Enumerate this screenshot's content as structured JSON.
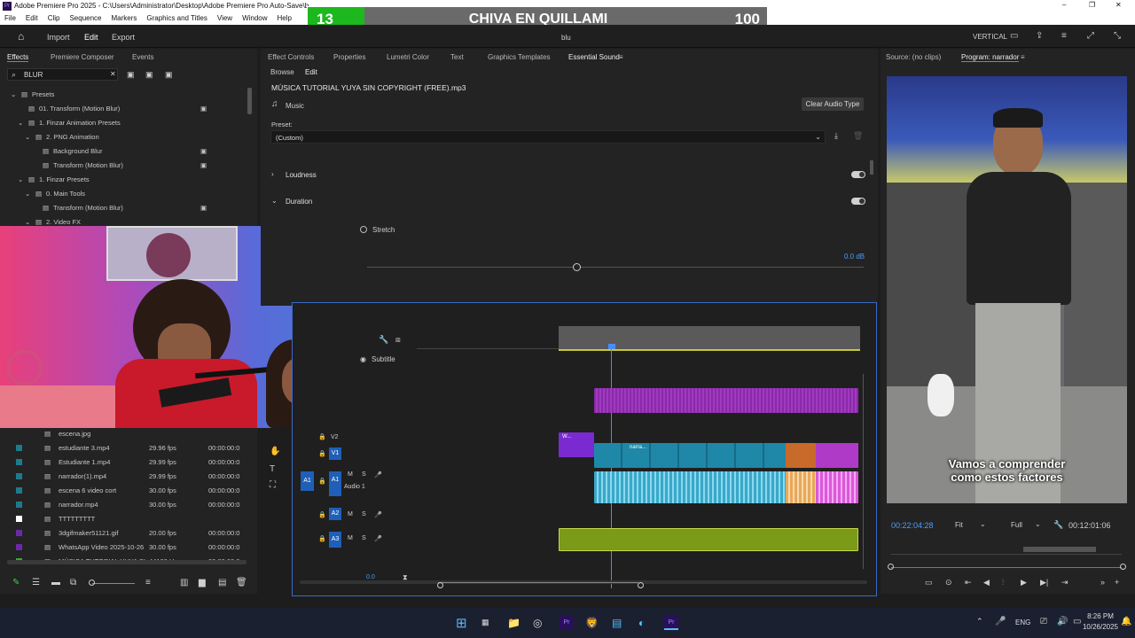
{
  "window": {
    "title": "Adobe Premiere Pro 2025 - C:\\Users\\Administrator\\Desktop\\Adobe Premiere Pro Auto-Save\\b",
    "minimize": "–",
    "maximize": "❐",
    "close": "✕"
  },
  "menu": [
    "File",
    "Edit",
    "Clip",
    "Sequence",
    "Markers",
    "Graphics and Titles",
    "View",
    "Window",
    "Help"
  ],
  "nav": {
    "import": "Import",
    "edit": "Edit",
    "export": "Export",
    "sequence_name": "blu",
    "workspace": "VERTICAL"
  },
  "scoreboard": {
    "left": "13",
    "center": "CHIVA EN QUILLAMI",
    "right": "100",
    "colors": {
      "left": "#1db81d",
      "bar": "#6a6a6a"
    }
  },
  "effects_panel": {
    "tabs": [
      "Effects",
      "Premiere Composer",
      "Events"
    ],
    "search_value": "BLUR",
    "tree": [
      {
        "label": "Presets",
        "indent": 0,
        "type": "folder"
      },
      {
        "label": "01. Transform (Motion Blur)",
        "indent": 1,
        "type": "item"
      },
      {
        "label": "1. Finzar Animation Presets",
        "indent": 1,
        "type": "folder"
      },
      {
        "label": "2. PNG Animation",
        "indent": 2,
        "type": "folder"
      },
      {
        "label": "Background Blur",
        "indent": 3,
        "type": "item"
      },
      {
        "label": "Transform (Motion Blur)",
        "indent": 3,
        "type": "item"
      },
      {
        "label": "1. Finzar Presets",
        "indent": 1,
        "type": "folder"
      },
      {
        "label": "0. Main Tools",
        "indent": 2,
        "type": "folder"
      },
      {
        "label": "Transform (Motion Blur)",
        "indent": 3,
        "type": "item"
      },
      {
        "label": "2. Video FX",
        "indent": 2,
        "type": "folder"
      }
    ]
  },
  "project_list": [
    {
      "name": "escena.jpg",
      "fps": "",
      "dur": ""
    },
    {
      "name": "estudiante 3.mp4",
      "fps": "29.96 fps",
      "dur": "00:00:00:0",
      "color": "#1f7a8c"
    },
    {
      "name": "Estudiante 1.mp4",
      "fps": "29.99 fps",
      "dur": "00:00:00:0",
      "color": "#1f7a8c"
    },
    {
      "name": "narrador(1).mp4",
      "fps": "29.99 fps",
      "dur": "00:00:00:0",
      "color": "#1f7a8c"
    },
    {
      "name": "escena 6 video cort",
      "fps": "30.00 fps",
      "dur": "00:00:00:0",
      "color": "#1f7a8c"
    },
    {
      "name": "narrador.mp4",
      "fps": "30.00 fps",
      "dur": "00:00:00:0",
      "color": "#1f7a8c"
    },
    {
      "name": "TTTTTTTTT",
      "fps": "",
      "dur": "",
      "color": "#ffffff"
    },
    {
      "name": "3dgifmaker51121.gif",
      "fps": "20.00 fps",
      "dur": "00:00:00:0",
      "color": "#6a2aa8"
    },
    {
      "name": "WhatsApp Video 2025-10-26",
      "fps": "30.00 fps",
      "dur": "00:00:00:0",
      "color": "#6a2aa8"
    },
    {
      "name": "MÚSICA TUTORIAL YUYA SI",
      "fps": "44100 Hz",
      "dur": "00;00;00;0",
      "color": "#3aa83a"
    }
  ],
  "center_tabs": [
    "Effect Controls",
    "Properties",
    "Lumetri Color",
    "Text",
    "Graphics Templates",
    "Essential Sound"
  ],
  "essential_sound": {
    "subtabs": [
      "Browse",
      "Edit"
    ],
    "file": "MÚSICA TUTORIAL YUYA SIN COPYRIGHT (FREE).mp3",
    "type": "Music",
    "clear_button": "Clear Audio Type",
    "preset_label": "Preset:",
    "preset_value": "(Custom)",
    "loudness": "Loudness",
    "duration": "Duration",
    "stretch": "Stretch",
    "db_value": "0.0 dB"
  },
  "timeline": {
    "subtitle_label": "Subtitle",
    "tracks": [
      {
        "id": "V2",
        "label": "V2"
      },
      {
        "id": "V1",
        "label": "V1"
      },
      {
        "id": "A1",
        "label": "A1",
        "name": "Audio 1"
      },
      {
        "id": "A2",
        "label": "A2"
      },
      {
        "id": "A3",
        "label": "A3"
      }
    ],
    "zoom_value": "0.0",
    "clip_labels": {
      "w1": "W...",
      "w2": "W...",
      "narr": "narra...",
      "fx": "fx"
    }
  },
  "program_monitor": {
    "tabs": [
      "Source: (no clips)",
      "Program: narrador"
    ],
    "caption_line1": "Vamos a comprender",
    "caption_line2": "como estos factores",
    "timecode_current": "00:22:04:28",
    "fit": "Fit",
    "quality": "Full",
    "timecode_total": "00:12:01:06"
  },
  "taskbar": {
    "lang": "ENG",
    "time": "8:26 PM",
    "date": "10/26/2025"
  }
}
